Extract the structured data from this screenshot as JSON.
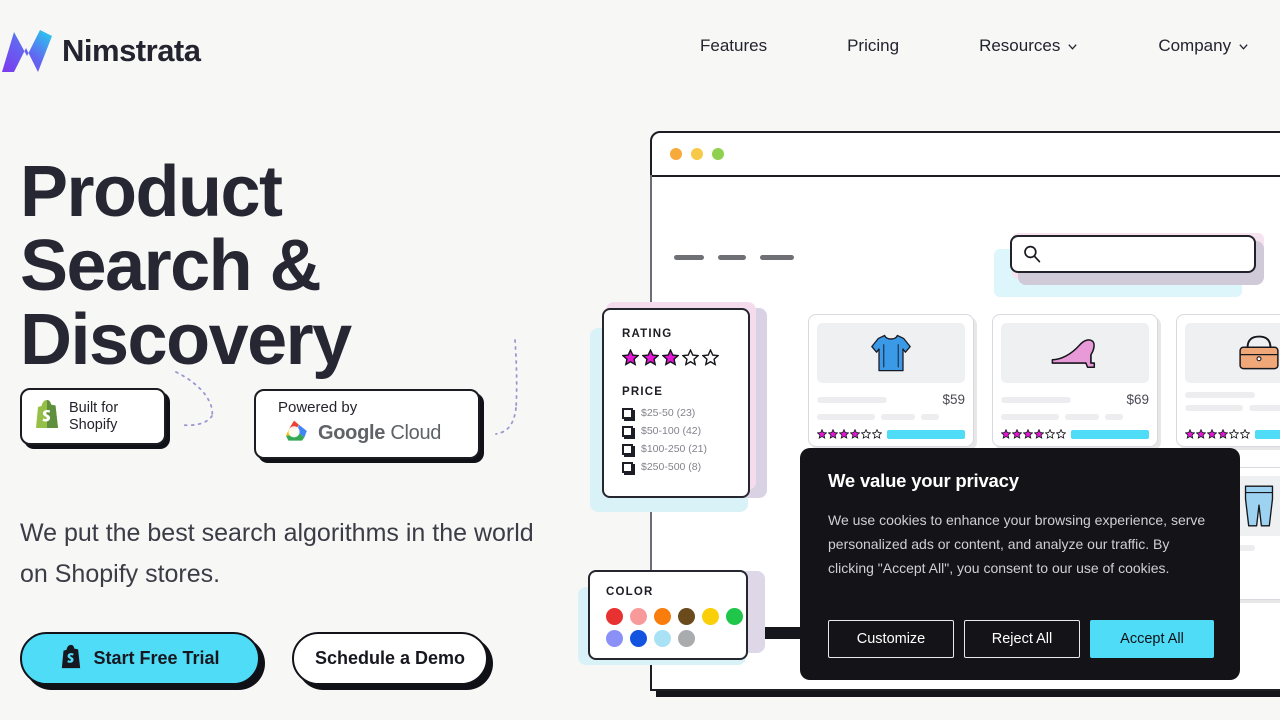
{
  "brand": {
    "name": "Nimstrata",
    "logo_icon": "nimstrata-n-logo",
    "gradient_from": "#8b5cf6",
    "gradient_to": "#22d3ee"
  },
  "nav": {
    "links": [
      {
        "label": "Features",
        "has_chevron": false
      },
      {
        "label": "Pricing",
        "has_chevron": false
      },
      {
        "label": "Resources",
        "has_chevron": true
      },
      {
        "label": "Company",
        "has_chevron": true
      }
    ]
  },
  "hero": {
    "heading_lines": [
      "Product",
      "Search &",
      "Discovery"
    ],
    "highlight_pink": "#fbdcec",
    "highlight_gray": "#eceaf1",
    "subtitle": "We put the best search algorithms in the world on Shopify stores.",
    "badges": [
      {
        "icon": "shopify-bag-icon",
        "line1": "Built for",
        "line2": "Shopify"
      },
      {
        "icon": "google-cloud-icon",
        "line1": "Powered by",
        "brand_bold": "Google",
        "brand_light": "Cloud"
      }
    ],
    "ctas": [
      {
        "label": "Start Free Trial",
        "icon": "shopify-bag-icon",
        "style": "primary",
        "color": "#4edcf7"
      },
      {
        "label": "Schedule a Demo",
        "icon": "",
        "style": "secondary",
        "color": "#ffffff"
      }
    ]
  },
  "browser": {
    "traffic_lights": [
      "#f7a93b",
      "#f7c948",
      "#8fd14f"
    ],
    "nav_dashes": [
      30,
      28,
      34
    ],
    "search": {
      "icon": "search-icon",
      "value": "",
      "placeholder": ""
    },
    "products": [
      {
        "icon": "sweater-icon",
        "price": "$59",
        "rating_filled": 4,
        "rating_total": 6
      },
      {
        "icon": "high-heel-icon",
        "price": "$69",
        "rating_filled": 4,
        "rating_total": 6
      },
      {
        "icon": "handbag-icon",
        "price": "",
        "rating_filled": 4,
        "rating_total": 6
      },
      {
        "icon": "dress-icon",
        "price": "",
        "rating_filled": 0,
        "rating_total": 0
      },
      {
        "icon": "sunglasses-icon",
        "price": "",
        "rating_filled": 0,
        "rating_total": 0
      },
      {
        "icon": "jeans-icon",
        "price": "",
        "rating_filled": 0,
        "rating_total": 0
      }
    ]
  },
  "filters": {
    "rating": {
      "title": "RATING",
      "filled": 3,
      "total": 5,
      "star_color": "#e715d8"
    },
    "price": {
      "title": "PRICE",
      "options": [
        {
          "label": "$25-50 (23)",
          "checked": false
        },
        {
          "label": "$50-100 (42)",
          "checked": false
        },
        {
          "label": "$100-250 (21)",
          "checked": false
        },
        {
          "label": "$250-500 (8)",
          "checked": false
        }
      ]
    },
    "color": {
      "title": "COLOR",
      "swatches": [
        "#e83131",
        "#f99a9a",
        "#f97d0c",
        "#6b4a1c",
        "#fbcf07",
        "#1fc64a",
        "#8b90f7",
        "#1253e0",
        "#a9e2f5",
        "#a9abad"
      ]
    }
  },
  "cookie": {
    "title": "We value your privacy",
    "body": "We use cookies to enhance your browsing experience, serve personalized ads or content, and analyze our traffic. By clicking \"Accept All\", you consent to our use of cookies.",
    "buttons": [
      {
        "label": "Customize",
        "style": "outline"
      },
      {
        "label": "Reject All",
        "style": "outline"
      },
      {
        "label": "Accept All",
        "style": "solid",
        "color": "#4edcf7"
      }
    ]
  }
}
